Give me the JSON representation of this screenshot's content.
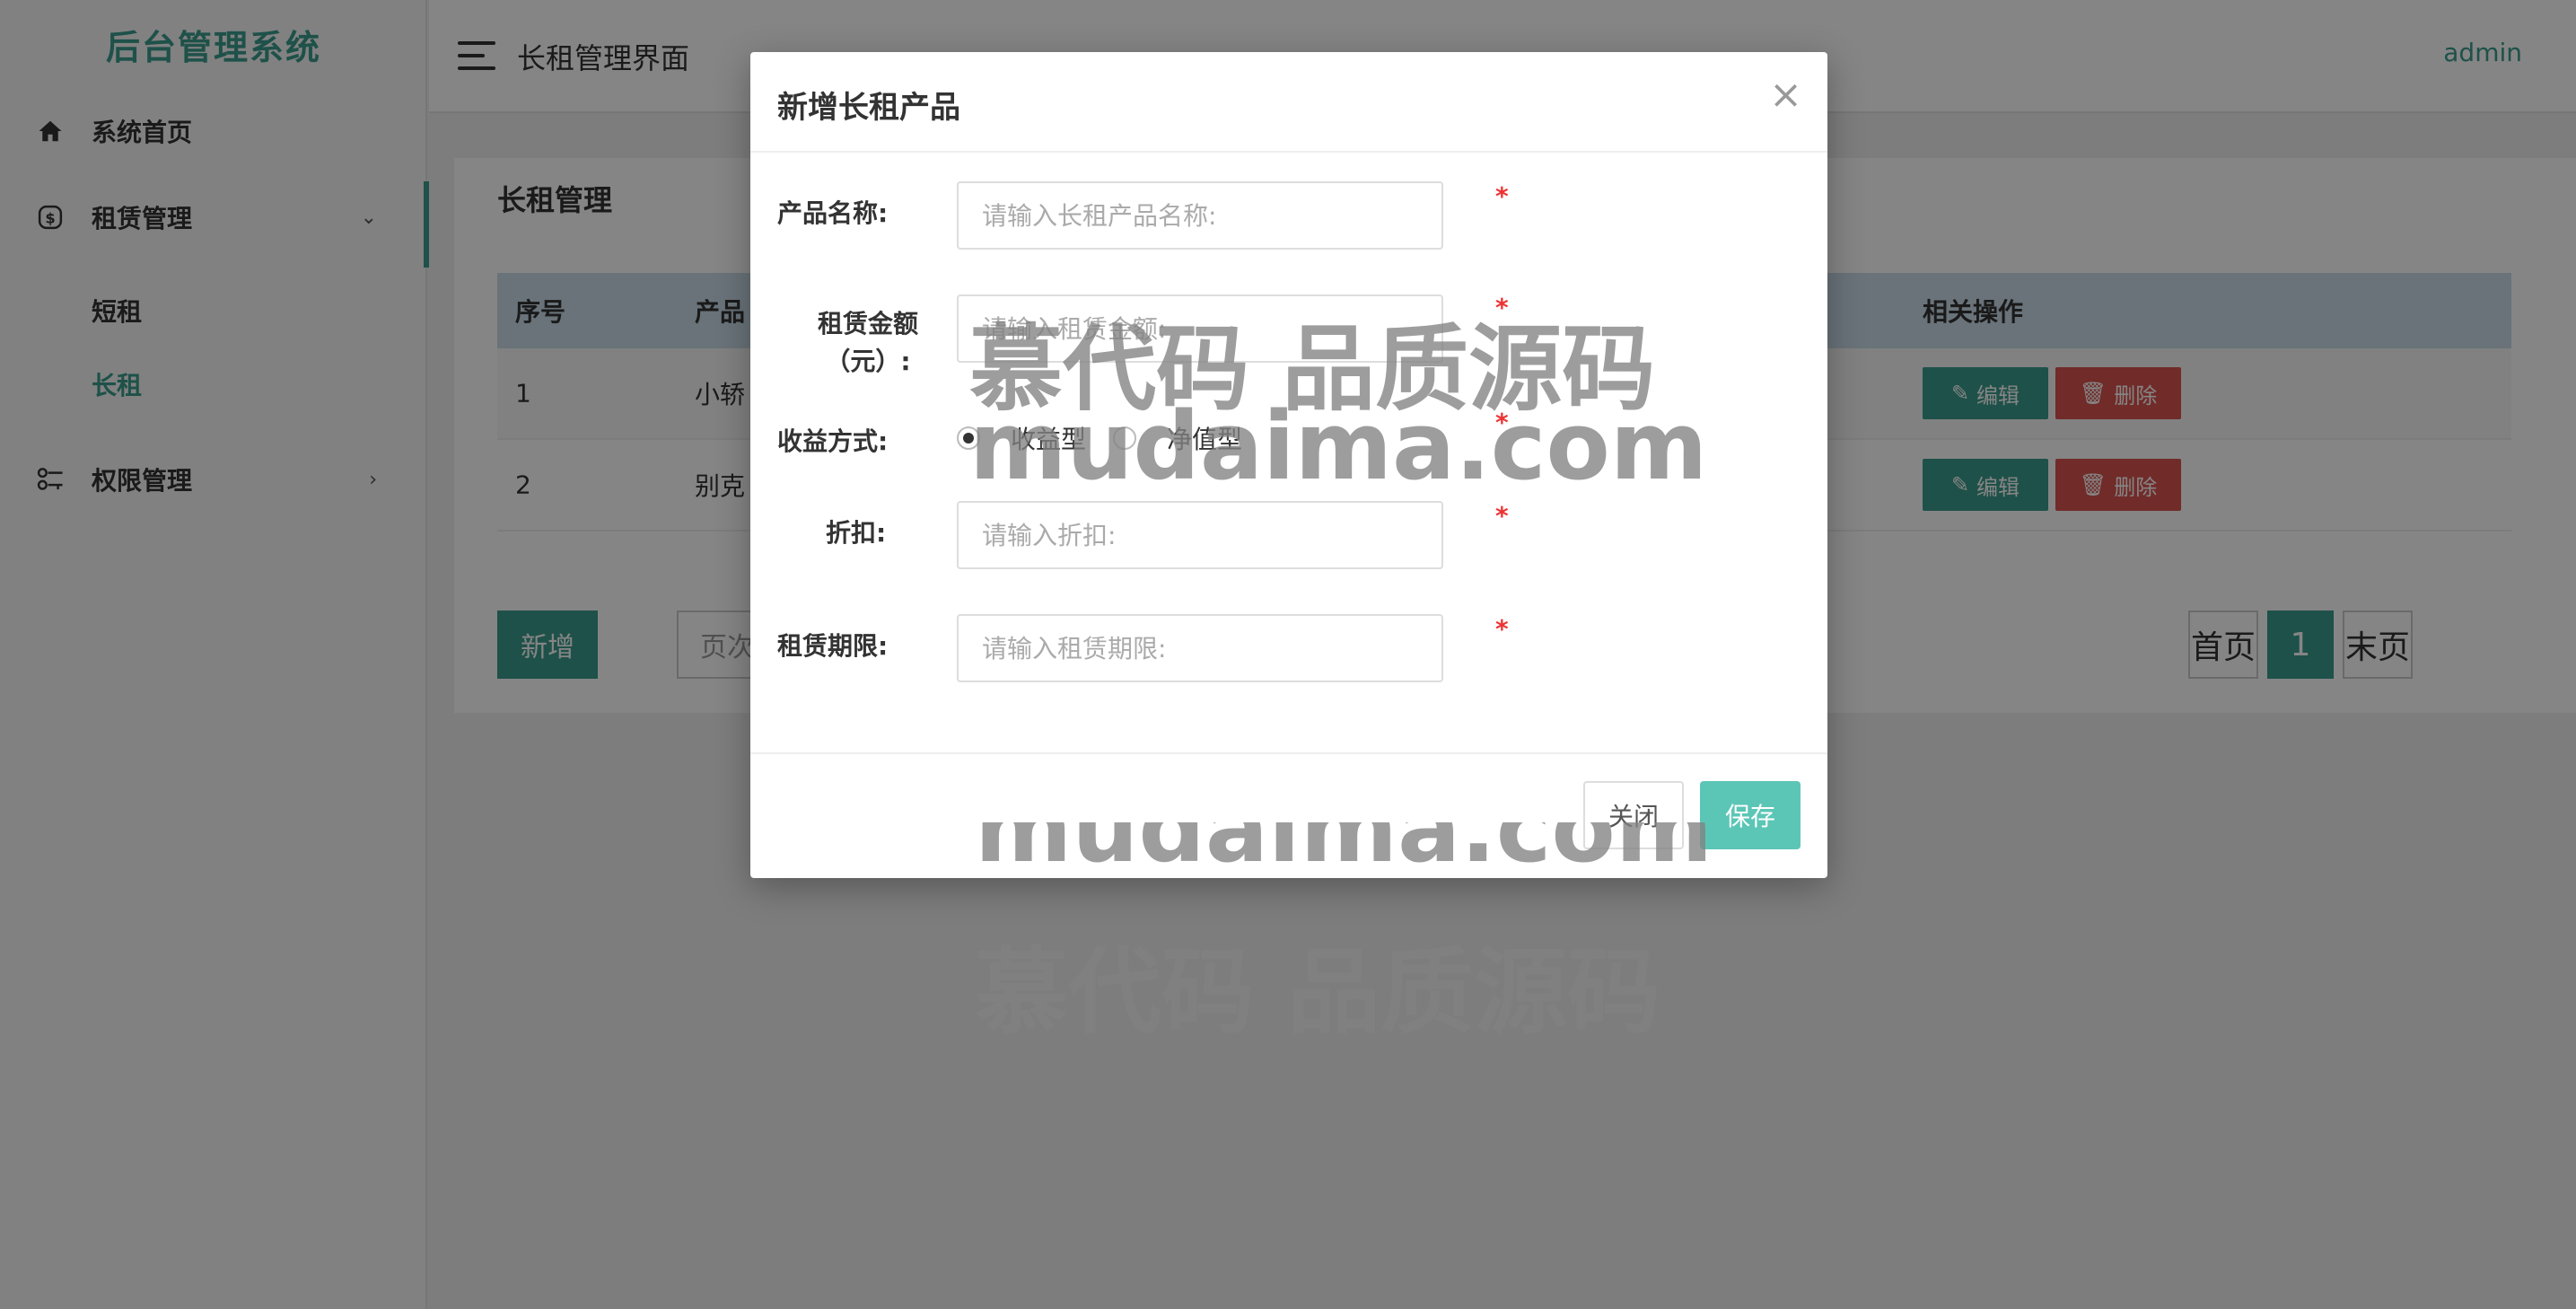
{
  "app": {
    "brand": "后台管理系统",
    "page_title": "长租管理界面",
    "user": "admin"
  },
  "sidebar": {
    "items": [
      {
        "label": "系统首页",
        "icon": "home-icon"
      },
      {
        "label": "租赁管理",
        "icon": "currency-icon",
        "arrow": "⌄"
      },
      {
        "label": "权限管理",
        "icon": "permission-icon",
        "arrow": "›"
      }
    ],
    "sub_items": [
      {
        "label": "短租",
        "active": false
      },
      {
        "label": "长租",
        "active": true
      }
    ]
  },
  "panel": {
    "title": "长租管理",
    "columns": [
      "序号",
      "产品",
      "相关操作"
    ],
    "rows": [
      {
        "index": "1",
        "name": "小轿",
        "edit": "编辑",
        "delete": "删除"
      },
      {
        "index": "2",
        "name": "别克",
        "edit": "编辑",
        "delete": "删除"
      }
    ],
    "add_label": "新增",
    "page_size_label": "页次",
    "pagination": {
      "first": "首页",
      "current": "1",
      "last": "末页"
    }
  },
  "modal": {
    "title": "新增长租产品",
    "close_symbol": "×",
    "fields": {
      "name": {
        "label": "产品名称:",
        "placeholder": "请输入长租产品名称:",
        "required": "*"
      },
      "amount": {
        "label_line1": "租赁金额",
        "label_line2": "（元）:",
        "placeholder": "请输入租赁金额:",
        "required": "*"
      },
      "income": {
        "label": "收益方式:",
        "options": [
          "收益型",
          "净值型"
        ],
        "selected": "收益型",
        "required": "*"
      },
      "discount": {
        "label": "折扣:",
        "placeholder": "请输入折扣:",
        "required": "*"
      },
      "period": {
        "label": "租赁期限:",
        "placeholder": "请输入租赁期限:",
        "required": "*"
      }
    },
    "close_label": "关闭",
    "save_label": "保存"
  },
  "watermark": {
    "cn": "慕代码 品质源码",
    "en": "mudaima.com"
  },
  "colors": {
    "accent": "#3a9c8c",
    "danger": "#d9534f",
    "save": "#5cc6b6"
  }
}
